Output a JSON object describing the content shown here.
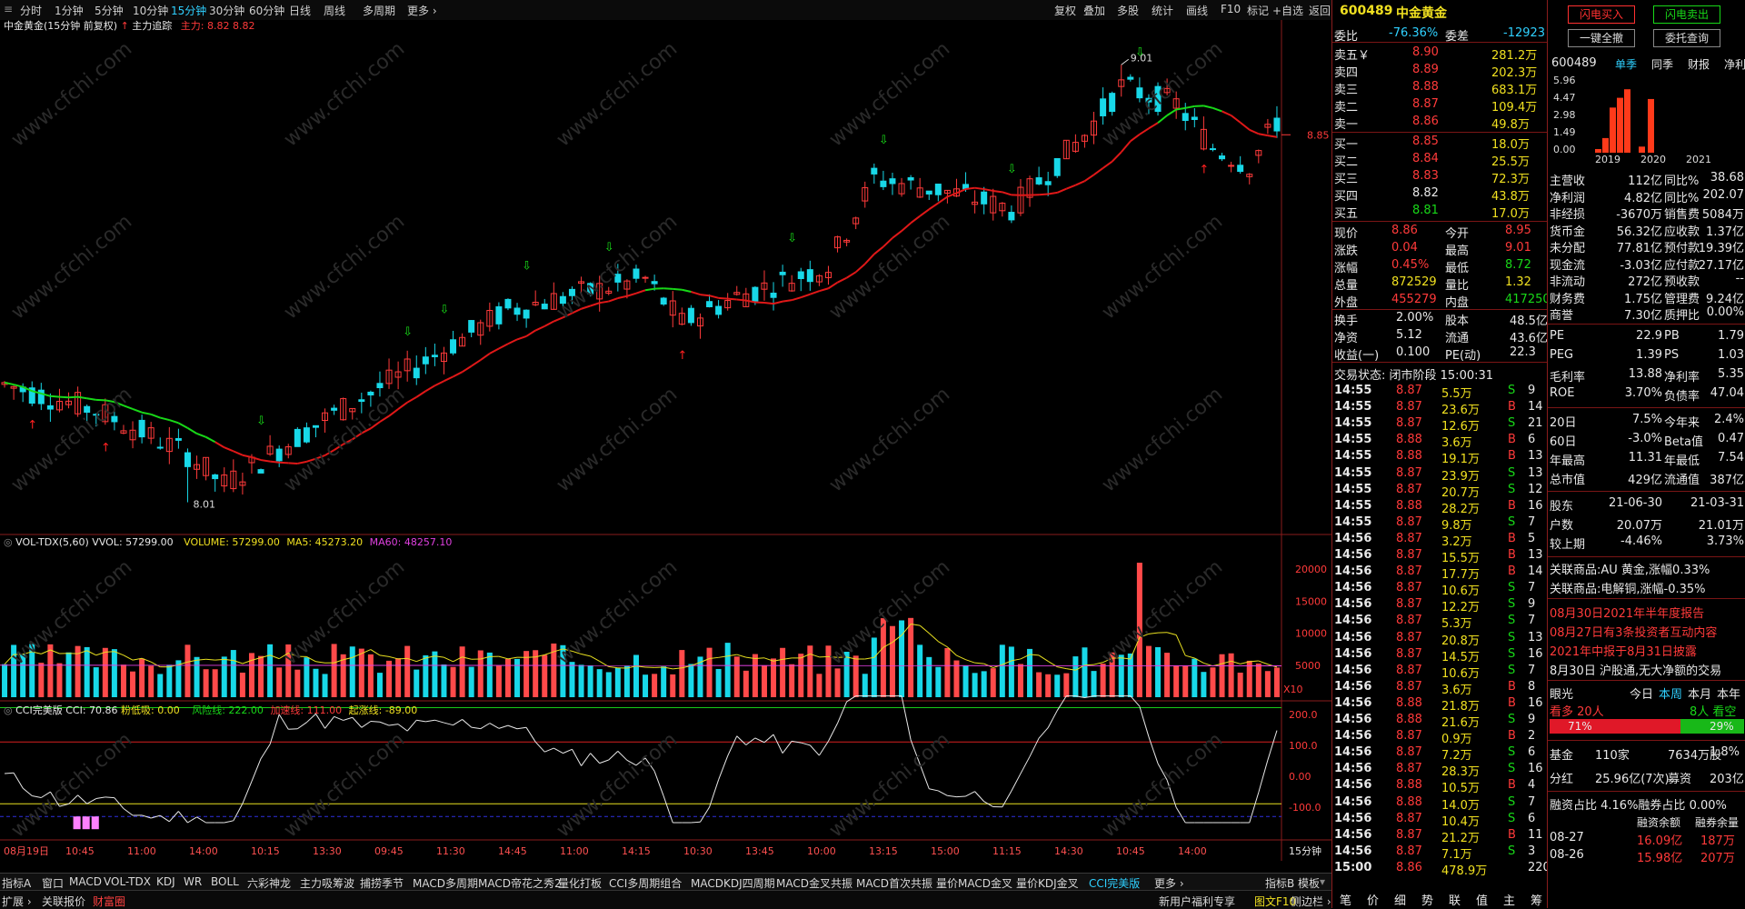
{
  "toolbar": {
    "periods": [
      "分时",
      "1分钟",
      "5分钟",
      "10分钟",
      "15分钟",
      "30分钟",
      "60分钟",
      "日线",
      "周线",
      "多周期",
      "更多 ›"
    ],
    "active_period": "15分钟",
    "right_tools": [
      "复权",
      "叠加",
      "多股",
      "统计",
      "画线",
      "F10",
      "标记",
      "+自选",
      "返回"
    ]
  },
  "main_pane": {
    "title": "中金黄金(15分钟 前复权)",
    "indicator": "主力追踪",
    "indicator_value": "主力: 8.82  8.82",
    "high_label": "9.01",
    "low_label": "8.01",
    "price_tick": "8.85"
  },
  "vol_pane": {
    "name": "VOL-TDX(5,60)",
    "vvol": "VVOL: 57299.00",
    "volume": "VOLUME: 57299.00",
    "ma5": "MA5: 45273.20",
    "ma60": "MA60: 48257.10",
    "ticks": [
      "20000",
      "15000",
      "10000",
      "5000"
    ],
    "unit": "X10"
  },
  "cci_pane": {
    "name": "CCI完美版",
    "cci": "CCI: 70.86",
    "fen": "粉低吸: 0.00",
    "risk": "风险线: 222.00",
    "speed": "加速线: 111.00",
    "start": "起涨线: -89.00",
    "ticks": [
      "200.0",
      "100.0",
      "0.00",
      "-100.0"
    ]
  },
  "time_axis": {
    "labels": [
      "08月19日",
      "10:45",
      "11:00",
      "14:00",
      "10:15",
      "13:30",
      "09:45",
      "11:30",
      "14:45",
      "11:00",
      "14:15",
      "10:30",
      "13:45",
      "10:00",
      "13:15",
      "15:00",
      "11:15",
      "14:30",
      "10:45",
      "14:00"
    ],
    "period_label": "15分钟"
  },
  "tabs_row1": [
    "指标A",
    "窗口",
    "MACD",
    "VOL-TDX",
    "KDJ",
    "WR",
    "BOLL",
    "六彩神龙",
    "主力吸筹波",
    "捕捞季节",
    "MACD多周期",
    "MACD帝花之秀2",
    "量化打板",
    "CCI多周期组合",
    "MACDKDJ四周期",
    "MACD金叉共振",
    "MACD首次共振",
    "量价MACD金叉",
    "量价KDJ金叉",
    "CCI完美版",
    "更多 ›"
  ],
  "tabs_row1_active": "CCI完美版",
  "tabs_row1_right": [
    "指标B",
    "模板"
  ],
  "tabs_row2": [
    "扩展 ›",
    "关联报价",
    "财富圈"
  ],
  "tabs_row2_right": [
    "新用户福利专享",
    "图文F10",
    "侧边栏 ›"
  ],
  "quote": {
    "code": "600489",
    "name": "中金黄金",
    "weibi_label": "委比",
    "weibi": "-76.36%",
    "weicha_label": "委差",
    "weicha": "-12923",
    "asks": [
      {
        "label": "卖五￥",
        "price": "8.90",
        "vol": "281.2万"
      },
      {
        "label": "卖四",
        "price": "8.89",
        "vol": "202.3万"
      },
      {
        "label": "卖三",
        "price": "8.88",
        "vol": "683.1万"
      },
      {
        "label": "卖二",
        "price": "8.87",
        "vol": "109.4万"
      },
      {
        "label": "卖一",
        "price": "8.86",
        "vol": "49.8万"
      }
    ],
    "bids": [
      {
        "label": "买一",
        "price": "8.85",
        "vol": "18.0万"
      },
      {
        "label": "买二",
        "price": "8.84",
        "vol": "25.5万"
      },
      {
        "label": "买三",
        "price": "8.83",
        "vol": "72.3万"
      },
      {
        "label": "买四",
        "price": "8.82",
        "vol": "43.8万"
      },
      {
        "label": "买五",
        "price": "8.81",
        "vol": "17.0万"
      }
    ],
    "stats": [
      {
        "l1": "现价",
        "v1": "8.86",
        "l2": "今开",
        "v2": "8.95"
      },
      {
        "l1": "涨跌",
        "v1": "0.04",
        "l2": "最高",
        "v2": "9.01"
      },
      {
        "l1": "涨幅",
        "v1": "0.45%",
        "l2": "最低",
        "v2": "8.72"
      },
      {
        "l1": "总量",
        "v1": "872529",
        "l2": "量比",
        "v2": "1.32"
      },
      {
        "l1": "外盘",
        "v1": "455279",
        "l2": "内盘",
        "v2": "417250"
      }
    ],
    "stats2": [
      {
        "l1": "换手",
        "v1": "2.00%",
        "l2": "股本",
        "v2": "48.5亿"
      },
      {
        "l1": "净资",
        "v1": "5.12",
        "l2": "流通",
        "v2": "43.6亿"
      },
      {
        "l1": "收益(一)",
        "v1": "0.100",
        "l2": "PE(动)",
        "v2": "22.3"
      }
    ],
    "trade_status": "交易状态: 闭市阶段 15:00:31",
    "ticks": [
      [
        "14:55",
        "8.87",
        "5.5万",
        "S",
        "9"
      ],
      [
        "14:55",
        "8.87",
        "23.6万",
        "B",
        "14"
      ],
      [
        "14:55",
        "8.87",
        "12.6万",
        "S",
        "21"
      ],
      [
        "14:55",
        "8.88",
        "3.6万",
        "B",
        "6"
      ],
      [
        "14:55",
        "8.88",
        "19.1万",
        "B",
        "13"
      ],
      [
        "14:55",
        "8.87",
        "23.9万",
        "S",
        "13"
      ],
      [
        "14:55",
        "8.87",
        "20.7万",
        "S",
        "12"
      ],
      [
        "14:55",
        "8.88",
        "28.2万",
        "B",
        "16"
      ],
      [
        "14:55",
        "8.87",
        "9.8万",
        "S",
        "7"
      ],
      [
        "14:56",
        "8.87",
        "3.2万",
        "B",
        "5"
      ],
      [
        "14:56",
        "8.87",
        "15.5万",
        "B",
        "13"
      ],
      [
        "14:56",
        "8.87",
        "17.7万",
        "B",
        "14"
      ],
      [
        "14:56",
        "8.87",
        "10.6万",
        "S",
        "7"
      ],
      [
        "14:56",
        "8.87",
        "12.2万",
        "S",
        "9"
      ],
      [
        "14:56",
        "8.87",
        "5.3万",
        "S",
        "7"
      ],
      [
        "14:56",
        "8.87",
        "20.8万",
        "S",
        "13"
      ],
      [
        "14:56",
        "8.87",
        "14.5万",
        "S",
        "16"
      ],
      [
        "14:56",
        "8.87",
        "10.6万",
        "S",
        "7"
      ],
      [
        "14:56",
        "8.87",
        "3.6万",
        "B",
        "8"
      ],
      [
        "14:56",
        "8.88",
        "21.8万",
        "B",
        "16"
      ],
      [
        "14:56",
        "8.88",
        "21.6万",
        "S",
        "9"
      ],
      [
        "14:56",
        "8.87",
        "0.9万",
        "B",
        "2"
      ],
      [
        "14:56",
        "8.87",
        "7.2万",
        "S",
        "6"
      ],
      [
        "14:56",
        "8.87",
        "28.3万",
        "S",
        "16"
      ],
      [
        "14:56",
        "8.88",
        "10.5万",
        "B",
        "4"
      ],
      [
        "14:56",
        "8.88",
        "14.0万",
        "S",
        "7"
      ],
      [
        "14:56",
        "8.87",
        "10.4万",
        "S",
        "6"
      ],
      [
        "14:56",
        "8.87",
        "21.2万",
        "B",
        "11"
      ],
      [
        "14:56",
        "8.87",
        "7.1万",
        "S",
        "3"
      ],
      [
        "15:00",
        "8.86",
        "478.9万",
        "",
        "220"
      ]
    ]
  },
  "fin": {
    "btn_buy": "闪电买入",
    "btn_sell": "闪电卖出",
    "btn_cancel": "一键全撤",
    "btn_query": "委托查询",
    "code": "600489",
    "tabs": [
      "单季",
      "同季",
      "财报",
      "净利润(亿)"
    ],
    "active_tab": "单季",
    "yticks": [
      "5.96",
      "4.47",
      "2.98",
      "1.49",
      "0.00"
    ],
    "years": [
      "2019",
      "2020",
      "2021"
    ],
    "chart_data": {
      "type": "bar",
      "title": "净利润(亿)",
      "categories": [
        "2019",
        "2020",
        "2021"
      ],
      "series": [
        {
          "values": [
            0.3,
            1.2,
            3.7,
            4.5,
            5.2
          ]
        },
        {
          "values": [
            0.5,
            4.4
          ]
        }
      ],
      "ylim": [
        0,
        5.96
      ]
    },
    "rows1": [
      [
        "主营收",
        "112亿",
        "同比%",
        "38.68"
      ],
      [
        "净利润",
        "4.82亿",
        "同比%",
        "202.07"
      ],
      [
        "非经损",
        "-3670万",
        "销售费",
        "5084万"
      ],
      [
        "货币金",
        "56.32亿",
        "应收款",
        "1.37亿"
      ],
      [
        "未分配",
        "77.81亿",
        "预付款",
        "19.39亿"
      ],
      [
        "现金流",
        "-3.03亿",
        "应付款",
        "27.17亿"
      ],
      [
        "非流动",
        "272亿",
        "预收款",
        "--"
      ],
      [
        "财务费",
        "1.75亿",
        "管理费",
        "9.24亿"
      ],
      [
        "商誉",
        "7.30亿",
        "质押比",
        "0.00%"
      ]
    ],
    "rows2": [
      [
        "PE",
        "22.9",
        "PB",
        "1.79"
      ],
      [
        "PEG",
        "1.39",
        "PS",
        "1.03"
      ],
      [
        "毛利率",
        "13.88",
        "净利率",
        "5.35"
      ],
      [
        "ROE",
        "3.70%",
        "负债率",
        "47.04"
      ]
    ],
    "rows3": [
      [
        "20日",
        "7.5%",
        "今年来",
        "2.4%"
      ],
      [
        "60日",
        "-3.0%",
        "Beta值",
        "0.47"
      ],
      [
        "年最高",
        "11.31",
        "年最低",
        "7.54"
      ],
      [
        "总市值",
        "429亿",
        "流通值",
        "387亿"
      ]
    ],
    "rows4": [
      [
        "股东",
        "21-06-30",
        "",
        "21-03-31"
      ],
      [
        "户数",
        "20.07万",
        "",
        "21.01万"
      ],
      [
        "较上期",
        "-4.46%",
        "",
        "3.73%"
      ]
    ],
    "related": [
      "关联商品:AU 黄金,涨幅0.33%",
      "关联商品:电解铜,涨幅-0.35%"
    ],
    "news": [
      "08月30日2021年半年度报告",
      "08月27日有3条投资者互动内容",
      "2021年中报于8月31日披露",
      "8月30日 沪股通,无大净额的交易"
    ],
    "eye": {
      "title": "眼光",
      "tabs": [
        "今日",
        "本周",
        "本月",
        "本年"
      ],
      "bull": "看多 20人",
      "bear": "8人 看空",
      "bull_pct": "71%",
      "bear_pct": "29%"
    },
    "fund": [
      "基金",
      "110家",
      "7634万股",
      "1.8%"
    ],
    "div": [
      "分红",
      "25.96亿(7次)",
      "募资",
      "203亿(2次)"
    ],
    "margin": "融资占比 4.16%融券占比 0.00%",
    "margin_hdr": [
      "",
      "融资余额",
      "融券余量"
    ],
    "margin_rows": [
      [
        "08-27",
        "16.09亿",
        "187万"
      ],
      [
        "08-26",
        "15.98亿",
        "207万"
      ]
    ]
  },
  "watermark": "www.cfchi.com",
  "colors": {
    "up": "#ff3a3a",
    "down": "#18d8e8",
    "ma_up": "#e01818",
    "ma_dn": "#18d818",
    "accent": "#2fd0ff"
  }
}
